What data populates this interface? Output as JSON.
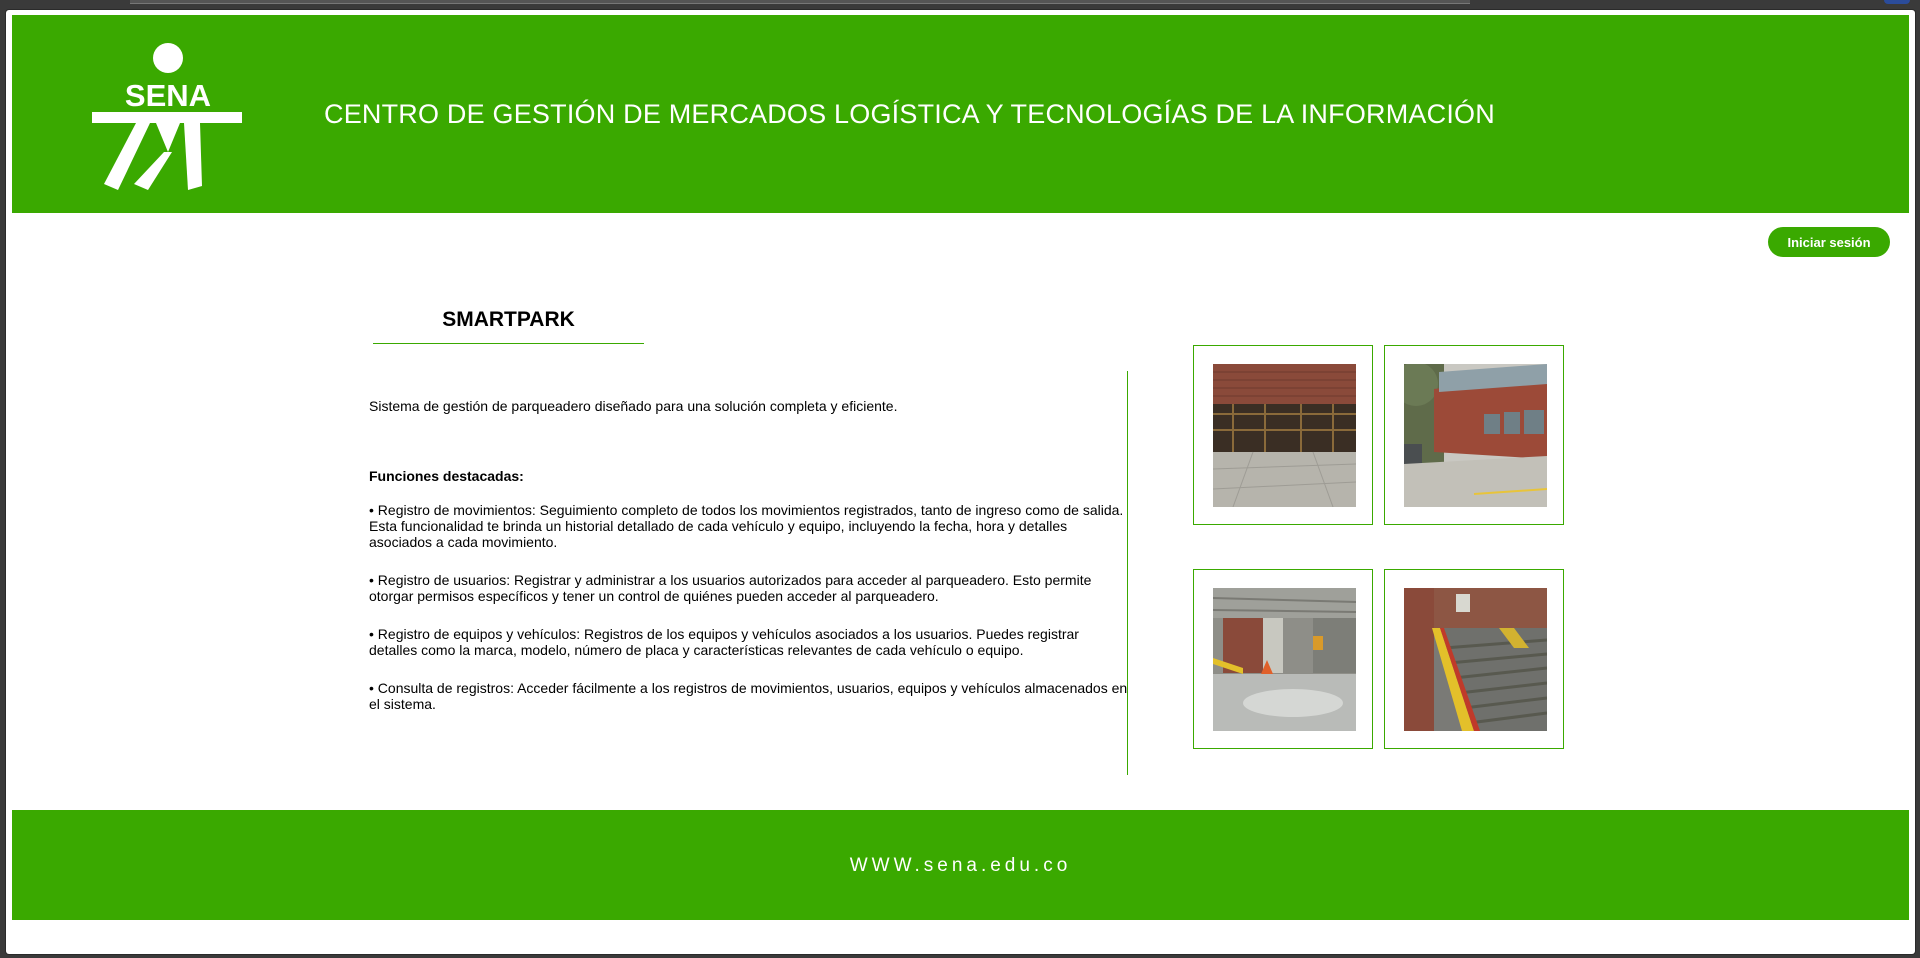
{
  "header": {
    "logo_text": "SENA",
    "title": "CENTRO DE GESTIÓN DE MERCADOS LOGÍSTICA Y TECNOLOGÍAS DE LA INFORMACIÓN"
  },
  "auth": {
    "login_label": "Iniciar sesión"
  },
  "main": {
    "title": "SMARTPARK",
    "intro": "Sistema de gestión de parqueadero diseñado para una solución completa y eficiente.",
    "features_heading": "Funciones destacadas:",
    "features": [
      "• Registro de movimientos: Seguimiento completo de todos los movimientos registrados, tanto de ingreso como de salida. Esta funcionalidad te brinda un historial detallado de cada vehículo y equipo, incluyendo la fecha, hora y detalles asociados a cada movimiento.",
      "• Registro de usuarios: Registrar y administrar a los usuarios autorizados para acceder al parqueadero. Esto permite otorgar permisos específicos y tener un control de quiénes pueden acceder al parqueadero.",
      "• Registro de equipos y vehículos: Registros de los equipos y vehículos asociados a los usuarios. Puedes registrar detalles como la marca, modelo, número de placa y características relevantes de cada vehículo o equipo.",
      "• Consulta de registros: Acceder fácilmente a los registros de movimientos, usuarios, equipos y vehículos almacenados en el sistema."
    ]
  },
  "gallery": {
    "photos": [
      "parking-entrance-photo",
      "building-exterior-photo",
      "parking-interior-photo",
      "parking-ramp-photo"
    ]
  },
  "footer": {
    "url": "WWW.sena.edu.co"
  },
  "colors": {
    "brand_green": "#3aa900",
    "white": "#ffffff"
  }
}
